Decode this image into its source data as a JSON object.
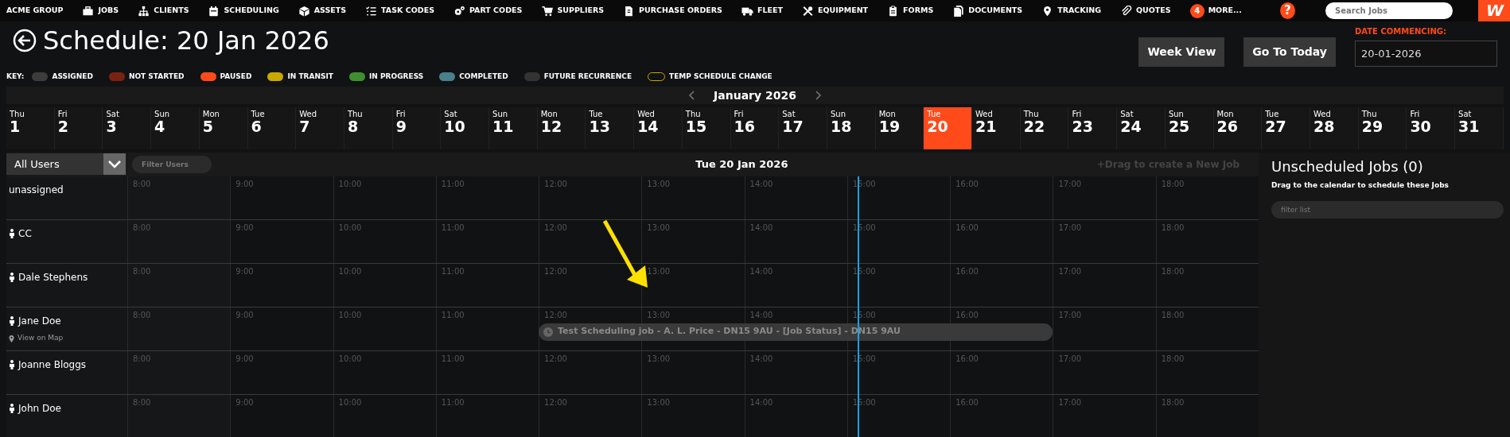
{
  "nav": {
    "brand": "ACME GROUP",
    "items": [
      {
        "label": "JOBS"
      },
      {
        "label": "CLIENTS"
      },
      {
        "label": "SCHEDULING"
      },
      {
        "label": "ASSETS"
      },
      {
        "label": "TASK CODES"
      },
      {
        "label": "PART CODES"
      },
      {
        "label": "SUPPLIERS"
      },
      {
        "label": "PURCHASE ORDERS"
      },
      {
        "label": "FLEET"
      },
      {
        "label": "EQUIPMENT"
      },
      {
        "label": "FORMS"
      },
      {
        "label": "DOCUMENTS"
      },
      {
        "label": "TRACKING"
      },
      {
        "label": "QUOTES"
      }
    ],
    "more": {
      "count": "4",
      "label": "MORE..."
    },
    "help": "?",
    "search": {
      "placeholder": "Search Jobs"
    },
    "logo": "W"
  },
  "title": "Schedule: 20 Jan 2026",
  "key": {
    "label": "KEY:",
    "items": [
      {
        "label": "ASSIGNED",
        "color": "#3c3c3c",
        "kind": "fill"
      },
      {
        "label": "NOT STARTED",
        "color": "#7a2212",
        "kind": "fill"
      },
      {
        "label": "PAUSED",
        "color": "#ff4a1a",
        "kind": "fill"
      },
      {
        "label": "IN TRANSIT",
        "color": "#c9a800",
        "kind": "fill"
      },
      {
        "label": "IN PROGRESS",
        "color": "#3f8f2e",
        "kind": "fill"
      },
      {
        "label": "COMPLETED",
        "color": "#4a7f8c",
        "kind": "fill"
      },
      {
        "label": "FUTURE RECURRENCE",
        "color": "#333333",
        "kind": "fill"
      },
      {
        "label": "TEMP SCHEDULE CHANGE",
        "color": "#c9a800",
        "kind": "outline"
      }
    ]
  },
  "buttons": [
    "Week View",
    "Go To Today"
  ],
  "date_commencing": {
    "label": "DATE COMMENCING:",
    "value": "20-01-2026"
  },
  "month": {
    "label": "January 2026"
  },
  "days": [
    {
      "dow": "Thu",
      "day": "1",
      "selected": false
    },
    {
      "dow": "Fri",
      "day": "2",
      "selected": false
    },
    {
      "dow": "Sat",
      "day": "3",
      "selected": false
    },
    {
      "dow": "Sun",
      "day": "4",
      "selected": false
    },
    {
      "dow": "Mon",
      "day": "5",
      "selected": false
    },
    {
      "dow": "Tue",
      "day": "6",
      "selected": false
    },
    {
      "dow": "Wed",
      "day": "7",
      "selected": false
    },
    {
      "dow": "Thu",
      "day": "8",
      "selected": false
    },
    {
      "dow": "Fri",
      "day": "9",
      "selected": false
    },
    {
      "dow": "Sat",
      "day": "10",
      "selected": false
    },
    {
      "dow": "Sun",
      "day": "11",
      "selected": false
    },
    {
      "dow": "Mon",
      "day": "12",
      "selected": false
    },
    {
      "dow": "Tue",
      "day": "13",
      "selected": false
    },
    {
      "dow": "Wed",
      "day": "14",
      "selected": false
    },
    {
      "dow": "Thu",
      "day": "15",
      "selected": false
    },
    {
      "dow": "Fri",
      "day": "16",
      "selected": false
    },
    {
      "dow": "Sat",
      "day": "17",
      "selected": false
    },
    {
      "dow": "Sun",
      "day": "18",
      "selected": false
    },
    {
      "dow": "Mon",
      "day": "19",
      "selected": false
    },
    {
      "dow": "Tue",
      "day": "20",
      "selected": true
    },
    {
      "dow": "Wed",
      "day": "21",
      "selected": false
    },
    {
      "dow": "Thu",
      "day": "22",
      "selected": false
    },
    {
      "dow": "Fri",
      "day": "23",
      "selected": false
    },
    {
      "dow": "Sat",
      "day": "24",
      "selected": false
    },
    {
      "dow": "Sun",
      "day": "25",
      "selected": false
    },
    {
      "dow": "Mon",
      "day": "26",
      "selected": false
    },
    {
      "dow": "Tue",
      "day": "27",
      "selected": false
    },
    {
      "dow": "Wed",
      "day": "28",
      "selected": false
    },
    {
      "dow": "Thu",
      "day": "29",
      "selected": false
    },
    {
      "dow": "Fri",
      "day": "30",
      "selected": false
    },
    {
      "dow": "Sat",
      "day": "31",
      "selected": false
    }
  ],
  "toolbar": {
    "user_select": "All Users",
    "filter": {
      "placeholder": "Filter Users"
    },
    "date": "Tue 20 Jan 2026",
    "drag_hint": "+Drag to create a New Job"
  },
  "rows": [
    {
      "name": "unassigned",
      "kind": "group",
      "hours": [
        "8:00",
        "9:00",
        "10:00",
        "11:00",
        "12:00",
        "13:00",
        "14:00",
        "15:00",
        "16:00",
        "17:00",
        "18:00"
      ]
    },
    {
      "name": "CC",
      "kind": "person",
      "hours": [
        "8:00",
        "9:00",
        "10:00",
        "11:00",
        "12:00",
        "13:00",
        "14:00",
        "15:00",
        "16:00",
        "17:00",
        "18:00"
      ]
    },
    {
      "name": "Dale Stephens",
      "kind": "person",
      "hours": [
        "8:00",
        "9:00",
        "10:00",
        "11:00",
        "12:00",
        "13:00",
        "14:00",
        "15:00",
        "16:00",
        "17:00",
        "18:00"
      ]
    },
    {
      "name": "Jane Doe",
      "kind": "person",
      "link": "View on Map",
      "hours": [
        "8:00",
        "9:00",
        "10:00",
        "11:00",
        "12:00",
        "13:00",
        "14:00",
        "15:00",
        "16:00",
        "17:00",
        "18:00"
      ],
      "jobs": [
        {
          "label": "Test Scheduling job - A. L. Price - DN15 9AU - [Job Status] - DN15 9AU"
        }
      ]
    },
    {
      "name": "Joanne Bloggs",
      "kind": "person",
      "hours": [
        "8:00",
        "9:00",
        "10:00",
        "11:00",
        "12:00",
        "13:00",
        "14:00",
        "15:00",
        "16:00",
        "17:00",
        "18:00"
      ]
    },
    {
      "name": "John Doe",
      "kind": "person",
      "hours": [
        "8:00",
        "9:00",
        "10:00",
        "11:00",
        "12:00",
        "13:00",
        "14:00",
        "15:00",
        "16:00",
        "17:00",
        "18:00"
      ]
    }
  ],
  "unscheduled": {
    "title": "Unscheduled Jobs (0)",
    "hint": "Drag to the calendar to schedule these Jobs",
    "filter": {
      "placeholder": "filter list"
    }
  }
}
